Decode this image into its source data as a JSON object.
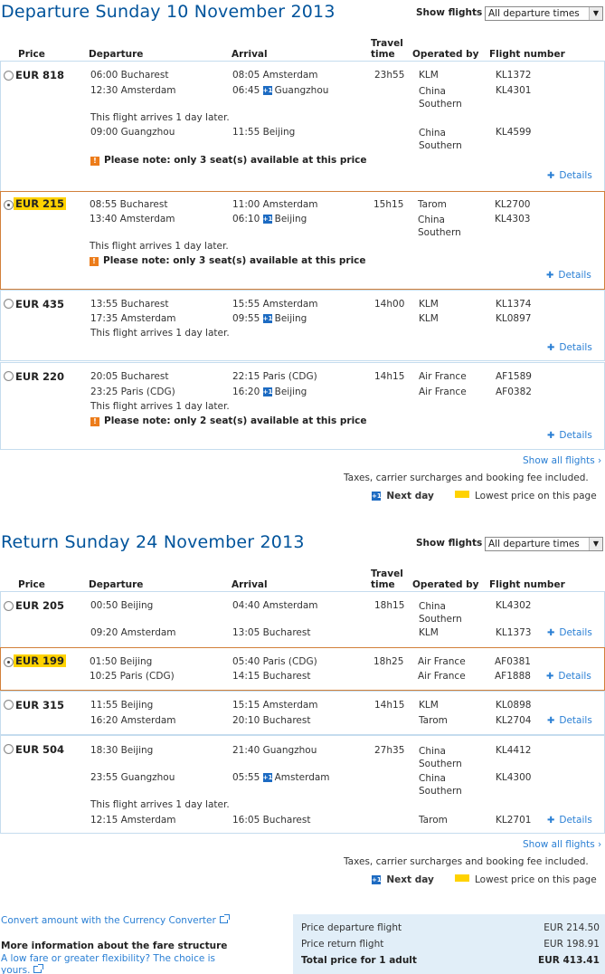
{
  "cols": {
    "price": "Price",
    "departure": "Departure",
    "arrival": "Arrival",
    "travel1": "Travel",
    "travel2": "time",
    "operated": "Operated by",
    "flightno": "Flight number"
  },
  "show_flights_label": "Show flights",
  "dropdown_value": "All departure times",
  "out": {
    "title": "Departure Sunday 10 November 2013",
    "show_all": "Show all flights",
    "f1": {
      "price": "EUR 818",
      "travel": "23h55",
      "s1": {
        "dep": "06:00 Bucharest",
        "arr": "08:05 Amsterdam",
        "op": "KLM",
        "no": "KL1372"
      },
      "s2": {
        "dep": "12:30 Amsterdam",
        "arr": "06:45",
        "arr_city": "Guangzhou",
        "op": "China Southern",
        "no": "KL4301"
      },
      "arrives": "This flight arrives 1 day later.",
      "s3": {
        "dep": "09:00 Guangzhou",
        "arr": "11:55 Beijing",
        "op": "China Southern",
        "no": "KL4599"
      },
      "warn": "Please note: only 3 seat(s) available at this price"
    },
    "f2": {
      "price": "EUR 215",
      "travel": "15h15",
      "s1": {
        "dep": "08:55 Bucharest",
        "arr": "11:00 Amsterdam",
        "op": "Tarom",
        "no": "KL2700"
      },
      "s2": {
        "dep": "13:40 Amsterdam",
        "arr": "06:10",
        "arr_city": "Beijing",
        "op": "China Southern",
        "no": "KL4303"
      },
      "arrives": "This flight arrives 1 day later.",
      "warn": "Please note: only 3 seat(s) available at this price"
    },
    "f3": {
      "price": "EUR 435",
      "travel": "14h00",
      "s1": {
        "dep": "13:55 Bucharest",
        "arr": "15:55 Amsterdam",
        "op": "KLM",
        "no": "KL1374"
      },
      "s2": {
        "dep": "17:35 Amsterdam",
        "arr": "09:55",
        "arr_city": "Beijing",
        "op": "KLM",
        "no": "KL0897"
      },
      "arrives": "This flight arrives 1 day later."
    },
    "f4": {
      "price": "EUR 220",
      "travel": "14h15",
      "s1": {
        "dep": "20:05 Bucharest",
        "arr": "22:15 Paris (CDG)",
        "op": "Air France",
        "no": "AF1589"
      },
      "s2": {
        "dep": "23:25 Paris (CDG)",
        "arr": "16:20",
        "arr_city": "Beijing",
        "op": "Air France",
        "no": "AF0382"
      },
      "arrives": "This flight arrives 1 day later.",
      "warn": "Please note: only 2 seat(s) available at this price"
    }
  },
  "ret": {
    "title": "Return Sunday 24 November 2013",
    "show_all": "Show all flights",
    "f1": {
      "price": "EUR 205",
      "travel": "18h15",
      "s1": {
        "dep": "00:50 Beijing",
        "arr": "04:40 Amsterdam",
        "op": "China Southern",
        "no": "KL4302"
      },
      "s2": {
        "dep": "09:20 Amsterdam",
        "arr": "13:05 Bucharest",
        "op": "KLM",
        "no": "KL1373"
      }
    },
    "f2": {
      "price": "EUR 199",
      "travel": "18h25",
      "s1": {
        "dep": "01:50 Beijing",
        "arr": "05:40 Paris (CDG)",
        "op": "Air France",
        "no": "AF0381"
      },
      "s2": {
        "dep": "10:25 Paris (CDG)",
        "arr": "14:15 Bucharest",
        "op": "Air France",
        "no": "AF1888"
      }
    },
    "f3": {
      "price": "EUR 315",
      "travel": "14h15",
      "s1": {
        "dep": "11:55 Beijing",
        "arr": "15:15 Amsterdam",
        "op": "KLM",
        "no": "KL0898"
      },
      "s2": {
        "dep": "16:20 Amsterdam",
        "arr": "20:10 Bucharest",
        "op": "Tarom",
        "no": "KL2704"
      }
    },
    "f4": {
      "price": "EUR 504",
      "travel": "27h35",
      "s1": {
        "dep": "18:30 Beijing",
        "arr": "21:40 Guangzhou",
        "op": "China Southern",
        "no": "KL4412"
      },
      "s2": {
        "dep": "23:55 Guangzhou",
        "arr": "05:55",
        "arr_city": "Amsterdam",
        "op": "China Southern",
        "no": "KL4300"
      },
      "arrives": "This flight arrives 1 day later.",
      "s3": {
        "dep": "12:15 Amsterdam",
        "arr": "16:05 Bucharest",
        "op": "Tarom",
        "no": "KL2701"
      }
    }
  },
  "details": "Details",
  "plus_label": "+1",
  "taxes": "Taxes, carrier surcharges and booking fee included.",
  "next_day": "Next day",
  "lowest": "Lowest price on this page",
  "converter": "Convert amount with the Currency Converter",
  "more_info": "More information about the fare structure",
  "low_fare": "A low fare or greater flexibility? The choice is yours.",
  "totals": {
    "dep_label": "Price departure flight",
    "dep_val": "EUR 214.50",
    "ret_label": "Price return flight",
    "ret_val": "EUR 198.91",
    "total_label": "Total price for 1 adult",
    "total_val": "EUR 413.41"
  },
  "colors": {
    "accent": "#00539b",
    "link": "#2a7fd4",
    "lowest": "#ffd200",
    "selected_border": "#d2803a",
    "warning": "#ec7c1a"
  }
}
